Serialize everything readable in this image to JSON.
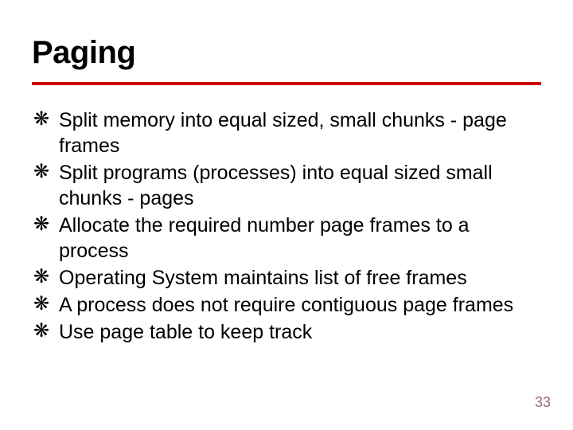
{
  "title": "Paging",
  "bullets": [
    "Split memory into equal sized, small chunks - page frames",
    "Split programs (processes) into equal sized small chunks - pages",
    "Allocate the required number page frames to a process",
    "Operating System maintains list of free frames",
    "A process does not require contiguous page frames",
    "Use page table to keep track"
  ],
  "bullet_marker": "❋",
  "page_number": "33",
  "accent_color": "#cc0000"
}
